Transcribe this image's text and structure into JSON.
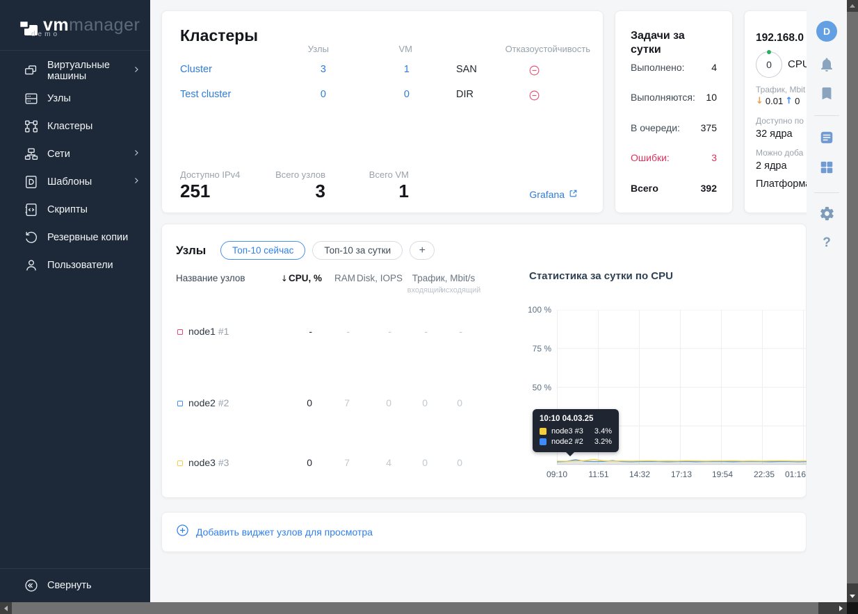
{
  "sidebar": {
    "logo": {
      "bold": "vm",
      "light": "manager",
      "sub": "demo"
    },
    "items": [
      {
        "label": "Виртуальные машины",
        "icon": "vm-icon",
        "expandable": true
      },
      {
        "label": "Узлы",
        "icon": "nodes-icon",
        "expandable": false
      },
      {
        "label": "Кластеры",
        "icon": "clusters-icon",
        "expandable": false
      },
      {
        "label": "Сети",
        "icon": "networks-icon",
        "expandable": true
      },
      {
        "label": "Шаблоны",
        "icon": "templates-icon",
        "expandable": true
      },
      {
        "label": "Скрипты",
        "icon": "scripts-icon",
        "expandable": false
      },
      {
        "label": "Резервные копии",
        "icon": "backups-icon",
        "expandable": false
      },
      {
        "label": "Пользователи",
        "icon": "users-icon",
        "expandable": false
      }
    ],
    "collapse_label": "Свернуть"
  },
  "clusters_card": {
    "title": "Кластеры",
    "columns": {
      "nodes": "Узлы",
      "vm": "VM",
      "ha": "Отказоустойчивость"
    },
    "rows": [
      {
        "name": "Cluster",
        "nodes": "3",
        "vm": "1",
        "storage": "SAN",
        "ha_status": "minus-circle-icon"
      },
      {
        "name": "Test cluster",
        "nodes": "0",
        "vm": "0",
        "storage": "DIR",
        "ha_status": "minus-circle-icon"
      }
    ],
    "stats": [
      {
        "label": "Доступно IPv4",
        "value": "251"
      },
      {
        "label": "Всего узлов",
        "value": "3"
      },
      {
        "label": "Всего VM",
        "value": "1"
      }
    ],
    "grafana_label": "Grafana"
  },
  "tasks_card": {
    "title": "Задачи за сутки",
    "rows": [
      {
        "label": "Выполнено:",
        "value": "4"
      },
      {
        "label": "Выполняются:",
        "value": "10"
      },
      {
        "label": "В очереди:",
        "value": "375"
      },
      {
        "label": "Ошибки:",
        "value": "3"
      },
      {
        "label": "Всего",
        "value": "392"
      }
    ]
  },
  "host_card": {
    "title": "192.168.0",
    "vm_count": "0",
    "cpu_label": "CPU",
    "traffic_label": "Трафик, Mbit",
    "traffic_down": "0.01",
    "traffic_up": "0",
    "available_label": "Доступно по",
    "available_value": "32 ядра",
    "can_add_label": "Можно доба",
    "can_add_value": "2 ядра",
    "platform_label": "Платформа"
  },
  "nodes_card": {
    "title": "Узлы",
    "tabs": [
      {
        "label": "Топ-10 сейчас",
        "active": true
      },
      {
        "label": "Топ-10 за сутки",
        "active": false
      }
    ],
    "add_tab_label": "+",
    "columns": {
      "name": "Название узлов",
      "cpu": "CPU, %",
      "ram": "RAM",
      "disk": "Disk, IOPS",
      "traffic": "Трафик, Mbit/s",
      "traffic_in": "входящий",
      "traffic_out": "исходящий"
    },
    "rows": [
      {
        "name": "node1",
        "id": "#1",
        "color": "#e84a6f",
        "cpu": "-",
        "ram": "-",
        "disk": "-",
        "in": "-",
        "out": "-"
      },
      {
        "name": "node2",
        "id": "#2",
        "color": "#3d8bfd",
        "cpu": "0",
        "ram": "7",
        "disk": "0",
        "in": "0",
        "out": "0"
      },
      {
        "name": "node3",
        "id": "#3",
        "color": "#f6cf3f",
        "cpu": "0",
        "ram": "7",
        "disk": "4",
        "in": "0",
        "out": "0"
      }
    ]
  },
  "chart_data": {
    "type": "line",
    "title": "Статистика за сутки по CPU",
    "unit": "%",
    "ylim": [
      0,
      100
    ],
    "grid": true,
    "y_ticks": [
      {
        "label": "100 %",
        "value": 100
      },
      {
        "label": "75 %",
        "value": 75
      },
      {
        "label": "50 %",
        "value": 50
      }
    ],
    "x_ticks": [
      "09:10",
      "11:51",
      "14:32",
      "17:13",
      "19:54",
      "22:35",
      "01:16"
    ],
    "series": [
      {
        "name": "node2 #2",
        "color": "#3d8bfd",
        "values": [
          1.9,
          2.1,
          3.2,
          2.2,
          2.0,
          2.1,
          2.6,
          2.0,
          1.9,
          2.0,
          2.1,
          2.0,
          1.9,
          2.0,
          2.1,
          1.9,
          2.0,
          2.1,
          2.0,
          1.9,
          2.0,
          2.1,
          2.0,
          1.9,
          2.0,
          2.0,
          1.9,
          2.0
        ]
      },
      {
        "name": "node3 #3",
        "color": "#f6cf3f",
        "values": [
          2.3,
          2.2,
          2.4,
          2.6,
          3.4,
          2.5,
          2.3,
          2.4,
          2.3,
          2.4,
          2.5,
          2.3,
          2.4,
          2.3,
          2.5,
          2.4,
          2.3,
          2.4,
          2.4,
          2.5,
          2.3,
          2.4,
          2.3,
          2.4,
          2.5,
          2.4,
          2.3,
          2.4
        ]
      }
    ],
    "tooltip": {
      "time": "10:10 04.03.25",
      "entries": [
        {
          "name": "node3 #3",
          "value": "3.4%",
          "color": "#f6cf3f"
        },
        {
          "name": "node2 #2",
          "value": "3.2%",
          "color": "#3d8bfd"
        }
      ]
    }
  },
  "add_widget": {
    "label": "Добавить виджет узлов для просмотра"
  },
  "rail": {
    "avatar": "D"
  },
  "icons": {
    "sort_down": "↓",
    "traffic_down": "↓",
    "traffic_up": "↑",
    "help": "?"
  },
  "colors": {
    "accent": "#2f80ed",
    "error": "#e0315b",
    "sidebar_bg": "#1d2938",
    "tooltip_bg": "#1f2631"
  }
}
